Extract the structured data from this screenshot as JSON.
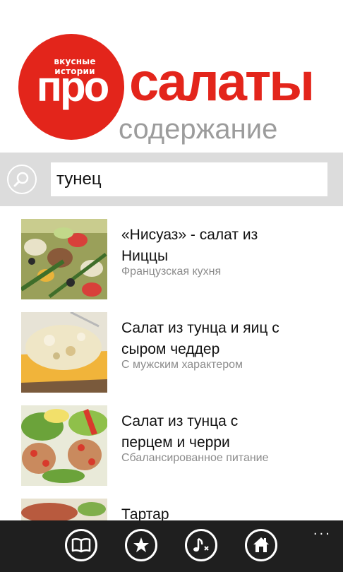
{
  "header": {
    "logo_small": "вкусные истории",
    "logo_main": "про",
    "brand_title": "салаты",
    "subtitle": "содержание"
  },
  "search": {
    "query": "тунец",
    "icon": "search-icon"
  },
  "results": [
    {
      "title_line1": "«Нисуаз» - салат из",
      "title_line2": "Ниццы",
      "subtitle": "Французская кухня"
    },
    {
      "title_line1": "Салат из тунца и яиц с",
      "title_line2": "сыром чеддер",
      "subtitle": "С мужским характером"
    },
    {
      "title_line1": "Салат из тунца с",
      "title_line2": "перцем и черри",
      "subtitle": "Сбалансированное питание"
    },
    {
      "title_line1": "Тартар",
      "title_line2": "",
      "subtitle": ""
    }
  ],
  "app_bar": {
    "buttons": [
      "book-icon",
      "star-icon",
      "music-note-icon",
      "home-icon"
    ],
    "more": "..."
  },
  "colors": {
    "brand_red": "#e3251b",
    "subtitle_gray": "#9c9c9c",
    "search_bg": "#dcdcdc",
    "app_bar_bg": "#1f1f1f"
  }
}
